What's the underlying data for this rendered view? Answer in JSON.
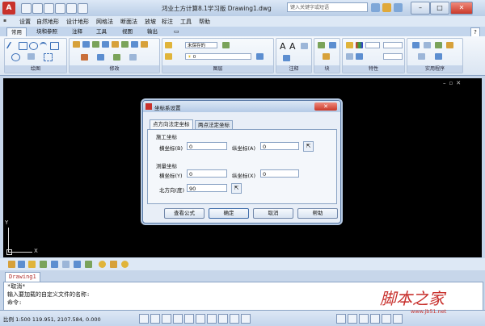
{
  "titlebar": {
    "title": "鸿业土方计算8.1学习版 Drawing1.dwg",
    "search_placeholder": "键入关键字或短语"
  },
  "menubar": [
    "设置",
    "自然地形",
    "设计地形",
    "网格法",
    "断面法",
    "放坡",
    "标注",
    "工具",
    "帮助"
  ],
  "ribbon_tabs": [
    "常用",
    "块和参照",
    "注释",
    "工具",
    "视图",
    "输出"
  ],
  "ribbon_panels": [
    "绘图",
    "修改",
    "图层",
    "注释",
    "块",
    "特性",
    "实用程序"
  ],
  "layer_combo": "未保存的",
  "layer_value": "0",
  "dialog": {
    "title": "坐标系设置",
    "tabs": [
      "点方向法定坐标",
      "两点法定坐标"
    ],
    "group_construction": "施工坐标",
    "x_label": "横坐标(B)",
    "x_value": "0",
    "y_label": "纵坐标(A)",
    "y_value": "0",
    "group_survey": "测量坐标",
    "sx_label": "横坐标(Y)",
    "sx_value": "0",
    "sy_label": "纵坐标(X)",
    "sy_value": "0",
    "north_label": "北方向(度)",
    "north_value": "90",
    "buttons": [
      "查看公式",
      "确定",
      "取消",
      "帮助"
    ]
  },
  "drawing_tab": "Drawing1",
  "command": {
    "line1": "*取消*",
    "line2": "输入要加载的自定义文件的名称:",
    "prompt": "命令:"
  },
  "status": {
    "coords": "比例 1:500  119.951, 2107.584, 0.000"
  },
  "watermark": {
    "text": "脚本之家",
    "url": "www.jb51.net"
  }
}
